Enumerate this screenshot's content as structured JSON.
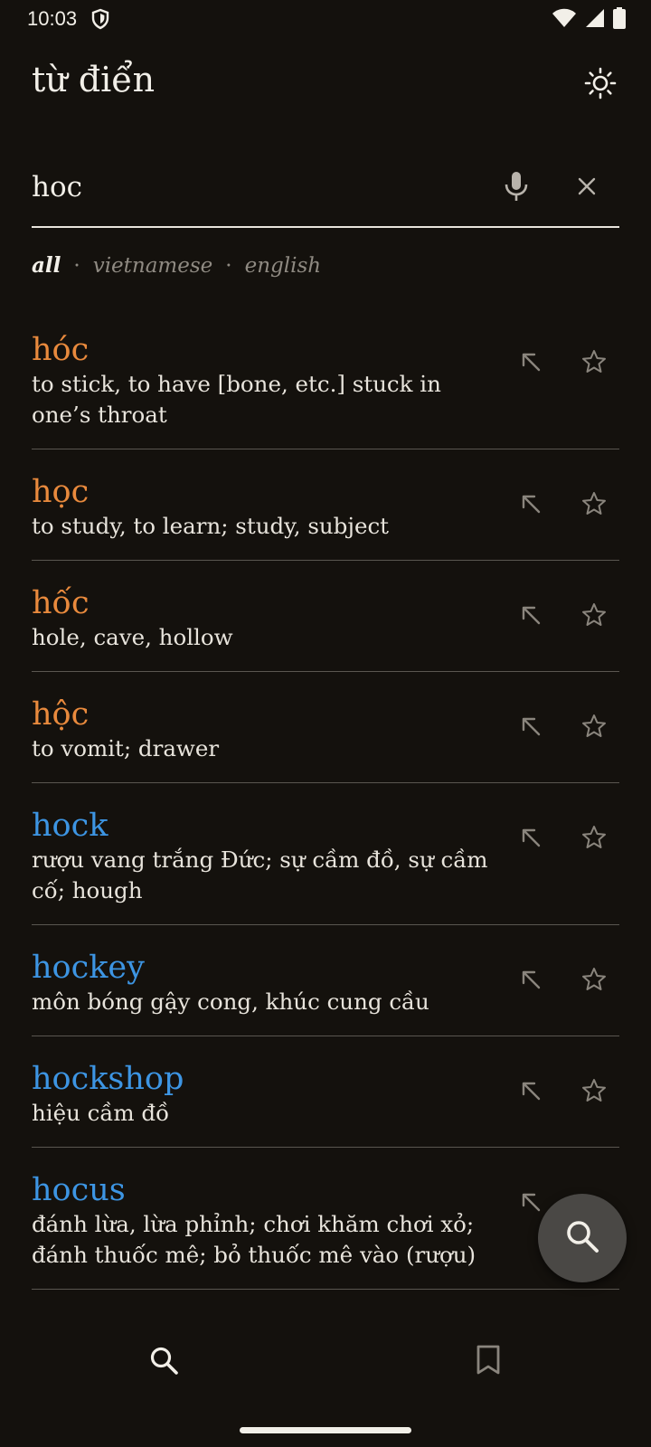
{
  "status_bar": {
    "time": "10:03"
  },
  "app": {
    "title": "từ điển"
  },
  "search": {
    "value": "hoc",
    "placeholder": ""
  },
  "filters": {
    "all": "all",
    "vietnamese": "vietnamese",
    "english": "english",
    "separator": "·"
  },
  "results": [
    {
      "word": "hóc",
      "lang": "vi",
      "definition": "to stick, to have [bone, etc.] stuck in one’s throat"
    },
    {
      "word": "học",
      "lang": "vi",
      "definition": "to study, to learn; study, subject"
    },
    {
      "word": "hốc",
      "lang": "vi",
      "definition": "hole, cave, hollow"
    },
    {
      "word": "hộc",
      "lang": "vi",
      "definition": "to vomit; drawer"
    },
    {
      "word": "hock",
      "lang": "en",
      "definition": "rượu vang trắng Đức; sự cầm đồ, sự cầm cố; hough"
    },
    {
      "word": "hockey",
      "lang": "en",
      "definition": "môn bóng gậy cong, khúc cung cầu"
    },
    {
      "word": "hockshop",
      "lang": "en",
      "definition": "hiệu cầm đồ"
    },
    {
      "word": "hocus",
      "lang": "en",
      "definition": "đánh lừa, lừa phỉnh; chơi khăm chơi xỏ; đánh thuốc mê; bỏ thuốc mê vào (rượu)"
    }
  ],
  "colors": {
    "vietnamese_word": "#e98a3d",
    "english_word": "#3d95e3",
    "background": "#14110d",
    "fab": "#4a4845"
  },
  "icons": {
    "status": [
      "shield-icon",
      "wifi-icon",
      "signal-icon",
      "battery-icon"
    ],
    "header": "sun-icon",
    "search": [
      "microphone-icon",
      "close-icon"
    ],
    "row": [
      "arrow-up-left-icon",
      "star-outline-icon"
    ],
    "fab": "search-icon",
    "nav": [
      "search-icon",
      "bookmark-icon"
    ]
  }
}
